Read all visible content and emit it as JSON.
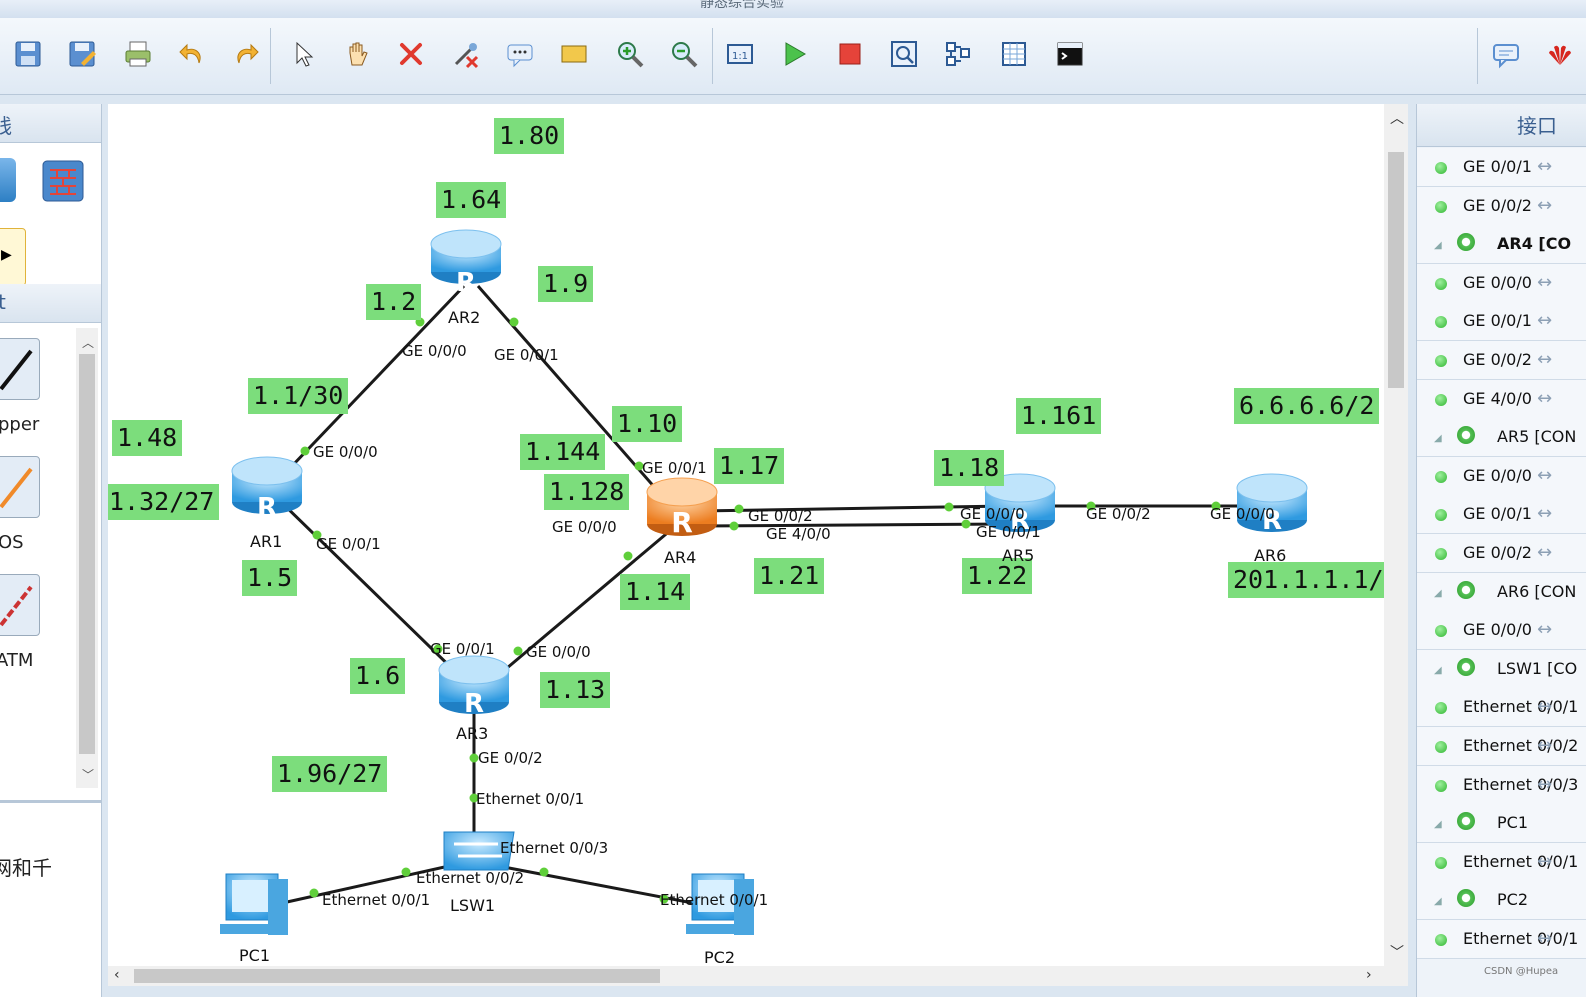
{
  "window": {
    "title": "静态综合实验"
  },
  "toolbar": {
    "left_icons": [
      "save-icon",
      "save-as-icon",
      "print-icon",
      "undo-icon",
      "redo-icon",
      "select-pointer-icon",
      "hand-pan-icon",
      "delete-icon",
      "delete-link-icon",
      "text-comment-icon",
      "rectangle-icon",
      "zoom-in-icon",
      "zoom-out-icon",
      "fit-window-icon",
      "start-device-icon",
      "stop-device-icon",
      "capture-icon",
      "topology-icon",
      "grid-icon",
      "console-icon"
    ],
    "right_icons": [
      "chat-icon",
      "huawei-logo-icon"
    ]
  },
  "left_panel": {
    "header1": "线",
    "header2": "t",
    "items": [
      "pper",
      "OS",
      "ATM"
    ],
    "description": "网和千"
  },
  "canvas": {
    "notes": {
      "n1_80": "1.80",
      "n1_64": "1.64",
      "n1_2": "1.2",
      "n1_9": "1.9",
      "n1_1_30": "1.1/30",
      "n1_10": "1.10",
      "n1_161": "1.161",
      "n6_6": "6.6.6.6/2",
      "n1_48": "1.48",
      "n1_144": "1.144",
      "n1_17": "1.17",
      "n1_18": "1.18",
      "n1_32_27": "1.32/27",
      "n1_128": "1.128",
      "n1_5": "1.5",
      "n1_14": "1.14",
      "n1_21": "1.21",
      "n1_22": "1.22",
      "n201": "201.1.1.1/",
      "n1_6": "1.6",
      "n1_13": "1.13",
      "n1_96_27": "1.96/27"
    },
    "devices": {
      "ar1": "AR1",
      "ar2": "AR2",
      "ar3": "AR3",
      "ar4": "AR4",
      "ar5": "AR5",
      "ar6": "AR6",
      "lsw1": "LSW1",
      "pc1": "PC1",
      "pc2": "PC2"
    },
    "ports": {
      "ar2_ge000": "GE 0/0/0",
      "ar2_ge001": "GE 0/0/1",
      "ar1_ge000": "GE 0/0/0",
      "ar1_ge001": "GE 0/0/1",
      "ar4_ge001": "GE 0/0/1",
      "ar4_ge000": "GE 0/0/0",
      "ar4_ge002": "GE 0/0/2",
      "ar4_ge400": "GE 4/0/0",
      "ar5_ge000": "GE 0/0/0",
      "ar5_ge001": "GE 0/0/1",
      "ar5_ge002": "GE 0/0/2",
      "ar6_ge000": "GE 0/0/0",
      "ar3_ge001": "GE 0/0/1",
      "ar3_ge000": "GE 0/0/0",
      "ar3_ge002": "GE 0/0/2",
      "lsw_e001": "Ethernet 0/0/1",
      "lsw_e003": "Ethernet 0/0/3",
      "lsw_e002": "Ethernet 0/0/2",
      "pc1_e001": "Ethernet 0/0/1",
      "pc2_e001": "Ethernet 0/0/1"
    }
  },
  "right_panel": {
    "header": "接口",
    "rows": [
      {
        "type": "port",
        "label": "GE 0/0/1"
      },
      {
        "type": "port",
        "label": "GE 0/0/2"
      },
      {
        "type": "device",
        "label": "AR4 [CO"
      },
      {
        "type": "port",
        "label": "GE 0/0/0"
      },
      {
        "type": "port",
        "label": "GE 0/0/1"
      },
      {
        "type": "port",
        "label": "GE 0/0/2"
      },
      {
        "type": "port",
        "label": "GE 4/0/0"
      },
      {
        "type": "device",
        "label": "AR5 [CON"
      },
      {
        "type": "port",
        "label": "GE 0/0/0"
      },
      {
        "type": "port",
        "label": "GE 0/0/1"
      },
      {
        "type": "port",
        "label": "GE 0/0/2"
      },
      {
        "type": "device",
        "label": "AR6 [CON"
      },
      {
        "type": "port",
        "label": "GE 0/0/0"
      },
      {
        "type": "device",
        "label": "LSW1 [CO"
      },
      {
        "type": "port",
        "label": "Ethernet 0/0/1"
      },
      {
        "type": "port",
        "label": "Ethernet 0/0/2"
      },
      {
        "type": "port",
        "label": "Ethernet 0/0/3"
      },
      {
        "type": "device",
        "label": "PC1"
      },
      {
        "type": "port",
        "label": "Ethernet 0/0/1"
      },
      {
        "type": "device",
        "label": "PC2"
      },
      {
        "type": "port",
        "label": "Ethernet 0/0/1"
      }
    ]
  },
  "watermark": "CSDN @Hupea",
  "colors": {
    "note_bg": "#7cdd7c",
    "link_dot": "#5fcf3a",
    "router_blue": "#3aa6e8",
    "router_orange": "#f08a2a"
  }
}
